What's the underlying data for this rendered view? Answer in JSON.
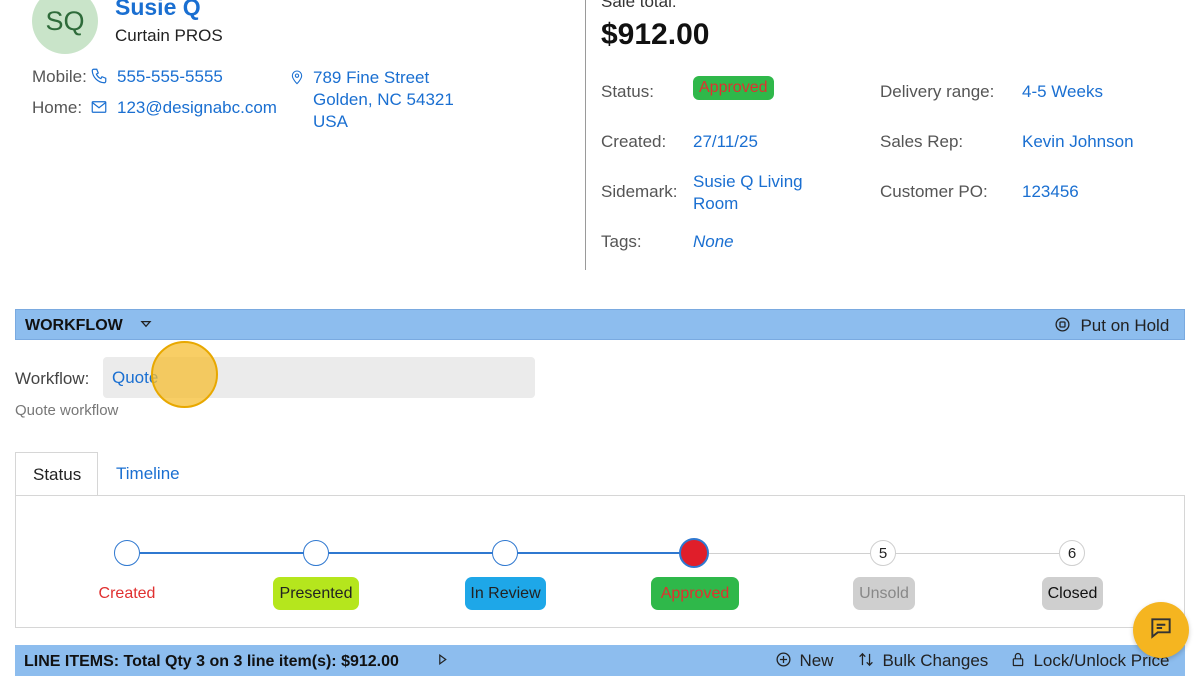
{
  "customer": {
    "initials": "SQ",
    "name": "Susie Q",
    "company": "Curtain PROS",
    "mobile_label": "Mobile:",
    "mobile": "555-555-5555",
    "home_label": "Home:",
    "email": "123@designabc.com",
    "address_line1": "789 Fine Street",
    "address_line2": "Golden, NC 54321",
    "address_line3": "USA"
  },
  "sale": {
    "total_label": "Sale total:",
    "total": "$912.00",
    "status_label": "Status:",
    "status": "Approved",
    "created_label": "Created:",
    "created": "27/11/25",
    "sidemark_label": "Sidemark:",
    "sidemark_line1": "Susie Q Living",
    "sidemark_line2": "Room",
    "tags_label": "Tags:",
    "tags": "None",
    "delivery_label": "Delivery range:",
    "delivery": "4-5 Weeks",
    "rep_label": "Sales Rep:",
    "rep": "Kevin Johnson",
    "po_label": "Customer PO:",
    "po": "123456"
  },
  "workflow": {
    "section_title": "WORKFLOW",
    "hold_label": "Put on Hold",
    "field_label": "Workflow:",
    "value": "Quote",
    "help": "Quote workflow"
  },
  "tabs": [
    {
      "label": "Status",
      "active": true
    },
    {
      "label": "Timeline",
      "active": false
    }
  ],
  "steps": [
    {
      "label": "Created",
      "number": "",
      "state": "done"
    },
    {
      "label": "Presented",
      "number": "",
      "state": "done"
    },
    {
      "label": "In Review",
      "number": "",
      "state": "done"
    },
    {
      "label": "Approved",
      "number": "",
      "state": "current"
    },
    {
      "label": "Unsold",
      "number": "5",
      "state": "todo"
    },
    {
      "label": "Closed",
      "number": "6",
      "state": "todo"
    }
  ],
  "line_items": {
    "title": "LINE ITEMS: Total Qty 3 on 3 line item(s): $912.00",
    "new_label": "New",
    "bulk_label": "Bulk Changes",
    "lock_label": "Lock/Unlock Price"
  },
  "colors": {
    "link": "#1a6fd1",
    "section_bar": "#8dbdee",
    "approved_badge": "#2fb84a",
    "approved_text": "#e03030",
    "presented_badge": "#b5e61d",
    "in_review_badge": "#1ea7e8",
    "inactive_badge": "#cfcfcf",
    "current_step": "#e01e2a",
    "chat_button": "#f5b520"
  },
  "icons": {
    "phone": "phone-icon",
    "email": "mail-icon",
    "location": "map-pin-icon",
    "collapse": "chevron-down-icon",
    "hold": "pause-circle-icon",
    "expand": "chevron-right-icon",
    "new": "plus-circle-icon",
    "bulk": "bulk-changes-icon",
    "lock": "lock-icon",
    "chat": "chat-icon"
  }
}
